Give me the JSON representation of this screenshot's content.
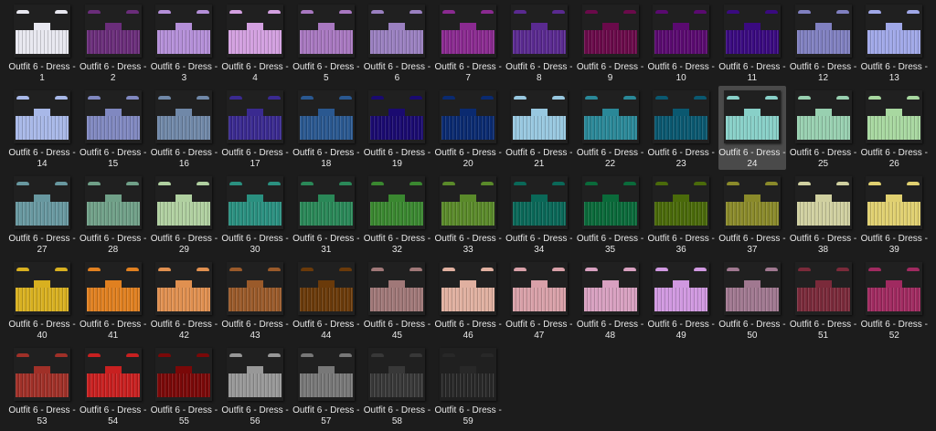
{
  "items": [
    {
      "label": "Outfit 6 - Dress - 1",
      "color": "#e8e8f0"
    },
    {
      "label": "Outfit 6 - Dress - 2",
      "color": "#6a2d7a"
    },
    {
      "label": "Outfit 6 - Dress - 3",
      "color": "#b48fd8"
    },
    {
      "label": "Outfit 6 - Dress - 4",
      "color": "#d3a0e0"
    },
    {
      "label": "Outfit 6 - Dress - 5",
      "color": "#a878c0"
    },
    {
      "label": "Outfit 6 - Dress - 6",
      "color": "#9a80c0"
    },
    {
      "label": "Outfit 6 - Dress - 7",
      "color": "#8a2a90"
    },
    {
      "label": "Outfit 6 - Dress - 8",
      "color": "#5a2a90"
    },
    {
      "label": "Outfit 6 - Dress - 9",
      "color": "#6a0a4a"
    },
    {
      "label": "Outfit 6 - Dress - 10",
      "color": "#5a0a70"
    },
    {
      "label": "Outfit 6 - Dress - 11",
      "color": "#3a0a80"
    },
    {
      "label": "Outfit 6 - Dress - 12",
      "color": "#8080c0"
    },
    {
      "label": "Outfit 6 - Dress - 13",
      "color": "#a0a8e8"
    },
    {
      "label": "Outfit 6 - Dress - 14",
      "color": "#a8b8e8"
    },
    {
      "label": "Outfit 6 - Dress - 15",
      "color": "#8088c0"
    },
    {
      "label": "Outfit 6 - Dress - 16",
      "color": "#7088a8"
    },
    {
      "label": "Outfit 6 - Dress - 17",
      "color": "#3a2a90"
    },
    {
      "label": "Outfit 6 - Dress - 18",
      "color": "#2a5890"
    },
    {
      "label": "Outfit 6 - Dress - 19",
      "color": "#1a0a70"
    },
    {
      "label": "Outfit 6 - Dress - 20",
      "color": "#0a2a70"
    },
    {
      "label": "Outfit 6 - Dress - 21",
      "color": "#98c8e0"
    },
    {
      "label": "Outfit 6 - Dress - 22",
      "color": "#2a8898"
    },
    {
      "label": "Outfit 6 - Dress - 23",
      "color": "#0a5870"
    },
    {
      "label": "Outfit 6 - Dress - 24",
      "color": "#88d0c8",
      "selected": true
    },
    {
      "label": "Outfit 6 - Dress - 25",
      "color": "#98d0b0"
    },
    {
      "label": "Outfit 6 - Dress - 26",
      "color": "#a8d8a0"
    },
    {
      "label": "Outfit 6 - Dress - 27",
      "color": "#6898a0"
    },
    {
      "label": "Outfit 6 - Dress - 28",
      "color": "#70a088"
    },
    {
      "label": "Outfit 6 - Dress - 29",
      "color": "#b0d0a0"
    },
    {
      "label": "Outfit 6 - Dress - 30",
      "color": "#2a9080"
    },
    {
      "label": "Outfit 6 - Dress - 31",
      "color": "#2a8858"
    },
    {
      "label": "Outfit 6 - Dress - 32",
      "color": "#3a8830"
    },
    {
      "label": "Outfit 6 - Dress - 33",
      "color": "#5a8a2a"
    },
    {
      "label": "Outfit 6 - Dress - 34",
      "color": "#0a6858"
    },
    {
      "label": "Outfit 6 - Dress - 35",
      "color": "#0a6a3a"
    },
    {
      "label": "Outfit 6 - Dress - 36",
      "color": "#4a6a0a"
    },
    {
      "label": "Outfit 6 - Dress - 37",
      "color": "#8a8a2a"
    },
    {
      "label": "Outfit 6 - Dress - 38",
      "color": "#d0d0a0"
    },
    {
      "label": "Outfit 6 - Dress - 39",
      "color": "#e0d070"
    },
    {
      "label": "Outfit 6 - Dress - 40",
      "color": "#d8b020"
    },
    {
      "label": "Outfit 6 - Dress - 41",
      "color": "#e08020"
    },
    {
      "label": "Outfit 6 - Dress - 42",
      "color": "#e09050"
    },
    {
      "label": "Outfit 6 - Dress - 43",
      "color": "#9a5a2a"
    },
    {
      "label": "Outfit 6 - Dress - 44",
      "color": "#6a3a0a"
    },
    {
      "label": "Outfit 6 - Dress - 45",
      "color": "#a07878"
    },
    {
      "label": "Outfit 6 - Dress - 46",
      "color": "#e0b0a0"
    },
    {
      "label": "Outfit 6 - Dress - 47",
      "color": "#d8a0a8"
    },
    {
      "label": "Outfit 6 - Dress - 48",
      "color": "#d8a0c0"
    },
    {
      "label": "Outfit 6 - Dress - 49",
      "color": "#d098e0"
    },
    {
      "label": "Outfit 6 - Dress - 50",
      "color": "#a07890"
    },
    {
      "label": "Outfit 6 - Dress - 51",
      "color": "#7a2a3a"
    },
    {
      "label": "Outfit 6 - Dress - 52",
      "color": "#a02a60"
    },
    {
      "label": "Outfit 6 - Dress - 53",
      "color": "#a03028"
    },
    {
      "label": "Outfit 6 - Dress - 54",
      "color": "#c82020"
    },
    {
      "label": "Outfit 6 - Dress - 55",
      "color": "#7a0808"
    },
    {
      "label": "Outfit 6 - Dress - 56",
      "color": "#989898"
    },
    {
      "label": "Outfit 6 - Dress - 57",
      "color": "#787878"
    },
    {
      "label": "Outfit 6 - Dress - 58",
      "color": "#383838"
    },
    {
      "label": "Outfit 6 - Dress - 59",
      "color": "#282828"
    }
  ]
}
